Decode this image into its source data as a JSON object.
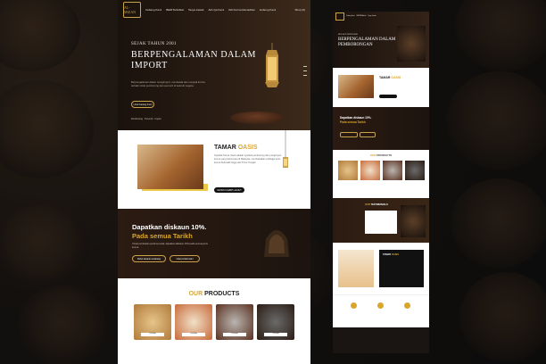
{
  "desktop": {
    "nav": {
      "logo_text": "AL-MIZAN",
      "items": [
        "Cabang Kami",
        "BERITA/Artikel",
        "Tanya Jawab",
        "Akh Qa Kami",
        "Gift Kurma Ramadhan",
        "Hubung Kami"
      ],
      "right": "Shop (0)"
    },
    "hero": {
      "since": "SEJAK TAHUN 2001",
      "headline": "BERPENGALAMAN DALAM IMPORT",
      "body": "Berpengalaman dalam mengimport, membekal dan menjual kurma terbaik untuk pemborong dan peruncit di seluruh negara.",
      "button": "Lihat Katalog Kami",
      "footer": "Pemborong · Peruncit · Import"
    },
    "tamar": {
      "title_plain": "TAMAR ",
      "title_accent": "OASIS",
      "body": "Syarikat Tamar Oasis adalah syarikat pemborong dan pengimport kurma yang terkemuka di Malaysia, membekalkan pelbagai jenis kurma berkualiti tinggi dari Timur Tengah.",
      "button": "KETAHUI LEBIH LANJUT"
    },
    "promo": {
      "headline": "Dapatkan diskaun 10%.",
      "headline_accent": "Pada semua Tarikh",
      "body": "Untuk pembelian pertama anda, dapatkan diskaun 10% pada semua jenis kurma.",
      "button_1": "Rebut tawaran sekarang",
      "button_2": "Lihat produk kami"
    },
    "products": {
      "title_accent": "OUR",
      "title_plain": " PRODUCTS",
      "items": [
        "KURMA",
        "KURMA",
        "KURMA",
        "KURMA"
      ]
    }
  },
  "mobile": {
    "hero": {
      "since": "SEJAK TAHUN 2001",
      "headline": "BERPENGALAMAN DALAM PEMBORONGAN"
    },
    "tamar": {
      "title_plain": "TAMAR ",
      "title_accent": "OASIS"
    },
    "promo": {
      "headline": "Dapatkan diskaun 10%.",
      "accent": "Pada semua Tarikh"
    },
    "products": {
      "title_accent": "OUR",
      "title_plain": " PRODUCTS"
    },
    "testimonials": {
      "title_accent": "OUR",
      "title_plain": " TESTIMONIALS"
    },
    "about": {
      "title_plain": "TAMAR ",
      "title_accent": "OASIS"
    }
  },
  "colors": {
    "gold": "#d9a62c",
    "dark": "#1b1410"
  }
}
